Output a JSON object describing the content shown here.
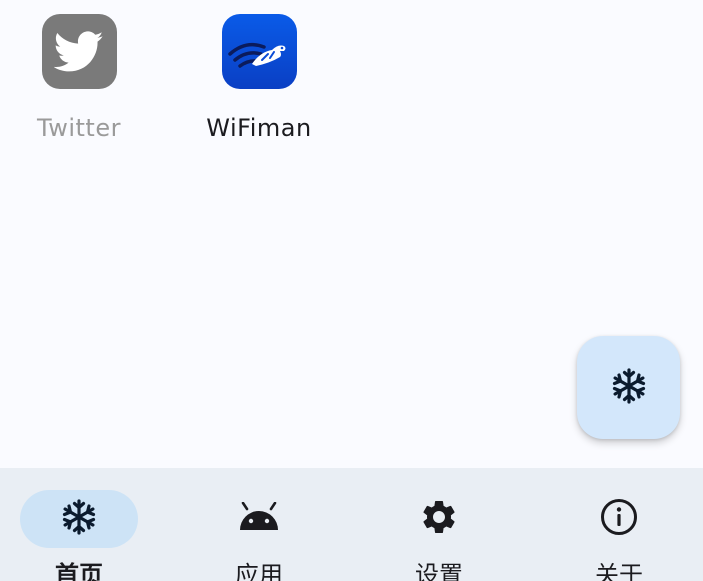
{
  "apps": [
    {
      "label": "Twitter",
      "icon": "twitter-bird-icon",
      "frozen": true
    },
    {
      "label": "WiFiman",
      "icon": "wifiman-icon",
      "frozen": false
    }
  ],
  "fab": {
    "icon": "snowflake-icon"
  },
  "nav": {
    "items": [
      {
        "label": "首页",
        "icon": "snowflake-icon",
        "active": true
      },
      {
        "label": "应用",
        "icon": "android-icon",
        "active": false
      },
      {
        "label": "设置",
        "icon": "gear-icon",
        "active": false
      },
      {
        "label": "关于",
        "icon": "info-icon",
        "active": false
      }
    ]
  },
  "colors": {
    "background": "#FAFBFF",
    "nav_background": "#E9EEF4",
    "active_indicator": "#CDE3F6",
    "fab_background": "#D3E7FB",
    "frozen_icon": "#7A7A7A",
    "wifiman_blue": "#0A4BD6",
    "text": "#1B1B1F",
    "frozen_text": "#9A9A9A"
  }
}
